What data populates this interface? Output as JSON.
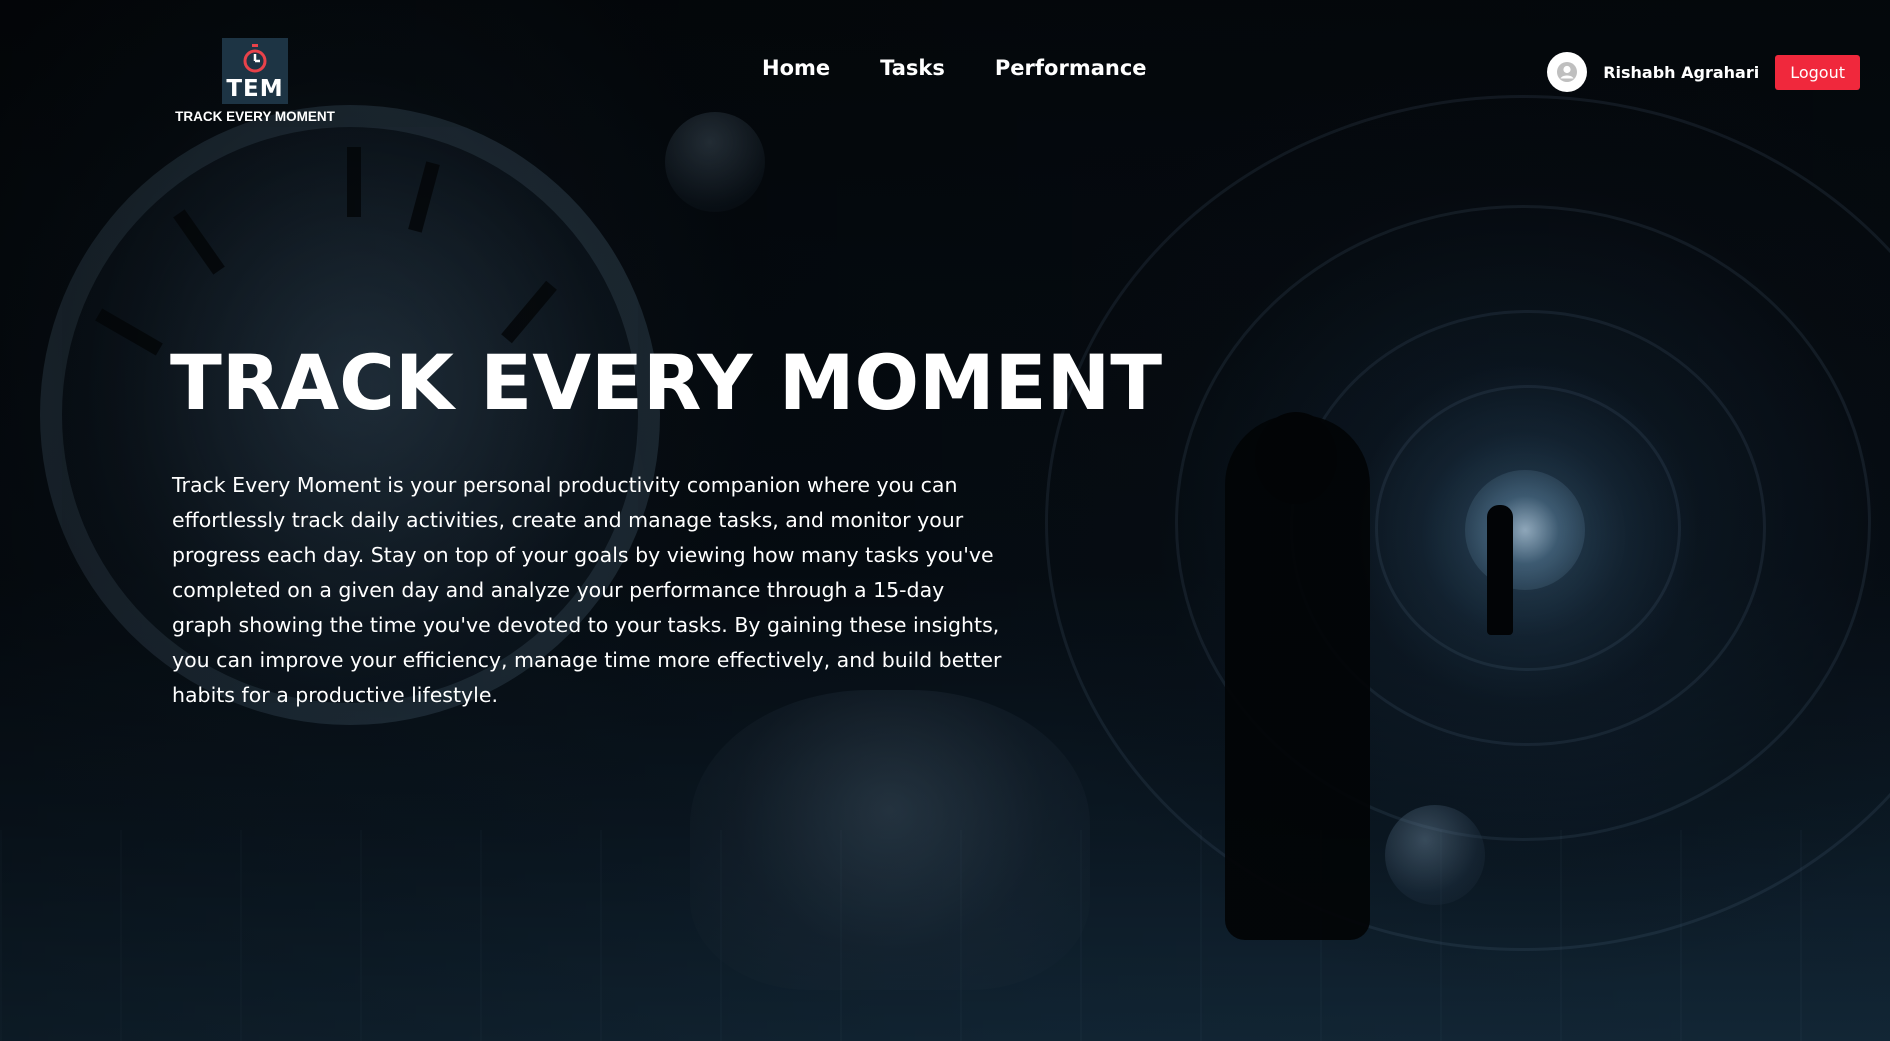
{
  "brand": {
    "logo_letters": "TEM",
    "logo_text": "TRACK EVERY MOMENT",
    "logo_icon": "stopwatch-icon",
    "badge_color": "#1d3444",
    "accent_color": "#e8424a"
  },
  "nav": {
    "items": [
      {
        "label": "Home"
      },
      {
        "label": "Tasks"
      },
      {
        "label": "Performance"
      }
    ]
  },
  "user": {
    "name": "Rishabh Agrahari",
    "avatar_icon": "user-avatar-icon",
    "logout_label": "Logout",
    "logout_color": "#f0283c"
  },
  "hero": {
    "title": "TRACK EVERY MOMENT",
    "description": "Track Every Moment is your personal productivity companion where you can effortlessly track daily activities, create and manage tasks, and monitor your progress each day. Stay on top of your goals by viewing how many tasks you've completed on a given day and analyze your performance through a 15-day graph showing the time you've devoted to your tasks. By gaining these insights, you can improve your efficiency, manage time more effectively, and build better habits for a productive lifestyle."
  }
}
